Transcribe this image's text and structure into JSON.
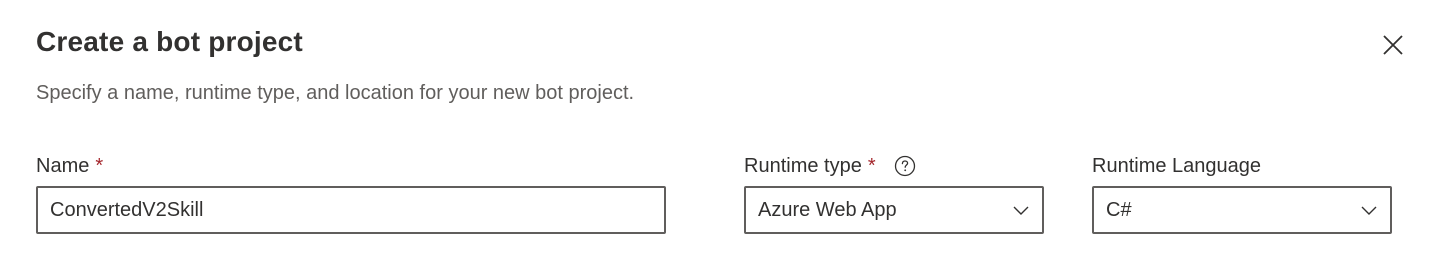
{
  "dialog": {
    "title": "Create a bot project",
    "subtitle": "Specify a name, runtime type, and location for your new bot project.",
    "close_icon": "close-icon"
  },
  "fields": {
    "name": {
      "label": "Name",
      "required_marker": "*",
      "value": "ConvertedV2Skill"
    },
    "runtime_type": {
      "label": "Runtime type",
      "required_marker": "*",
      "help_icon": "help-circle-icon",
      "selected": "Azure Web App"
    },
    "runtime_language": {
      "label": "Runtime Language",
      "selected": "C#"
    }
  },
  "colors": {
    "text": "#323130",
    "subtext": "#605e5c",
    "required": "#a4262c",
    "border": "#605e5c"
  }
}
